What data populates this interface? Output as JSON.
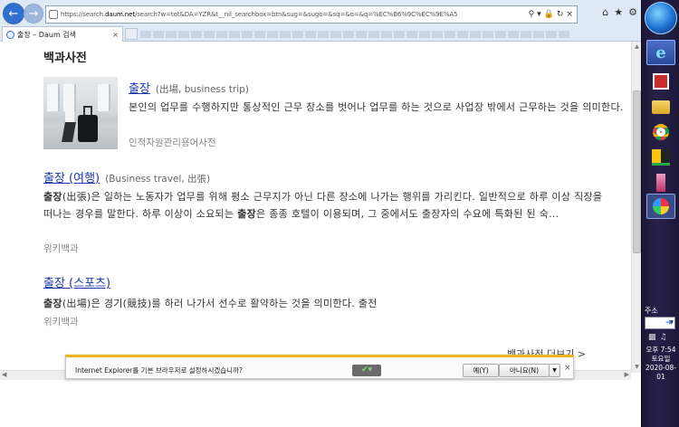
{
  "browser": {
    "url_prefix": "https://search.",
    "url_host": "daum.net",
    "url_rest": "/search?w=tot&DA=YZR&t__nil_searchbox=btn&sug=&sugo=&sq=&o=&q=%EC%B6%9C%EC%9E%A5",
    "tab_title": "출장 – Daum 검색",
    "tab_close": "×"
  },
  "page": {
    "section_title": "백과사전",
    "entries": [
      {
        "title": "출장",
        "subtitle": "(出場, business trip)",
        "description": "본인의 업무를 수행하지만 통상적인 근무 장소를 벗어나 업무를 하는 것으로 사업장 밖에서 근무하는 것을 의미한다.",
        "source": "인적자원관리용어사전"
      },
      {
        "title": "출장 (여행)",
        "subtitle": "(Business travel, 出張)",
        "description_bold_1": "출장",
        "description_part_1": "(出張)은 일하는 노동자가 업무를 위해 평소 근무지가 아닌 다른 장소에 나가는 행위를 가리킨다. 일반적으로 하루 이상 직장을 떠나는 경우를 말한다. 하루 이상이 소요되는 ",
        "description_bold_2": "출장",
        "description_part_2": "은 종종 호텔이 이용되며, 그 중에서도 출장자의 수요에 특화된 된 숙...",
        "source": "위키백과"
      },
      {
        "title": "출장 (스포츠)",
        "subtitle": "",
        "description_bold_1": "출장",
        "description_part_1": "(出場)은 경기(競技)를 하러 나가서 선수로 활약하는 것을 의미한다. 출전",
        "source": "위키백과"
      }
    ],
    "more_link": "백과사전 더보기 >"
  },
  "notification": {
    "message": "Internet Explorer를 기본 브라우저로 설정하시겠습니까?",
    "yes_label": "예(Y)",
    "no_label": "아니요(N)",
    "dropdown": "▼",
    "close": "×"
  },
  "taskbar": {
    "address_label": "주소",
    "clock_time": "오후 7:54",
    "clock_day": "토요일",
    "clock_date": "2020-08-01"
  },
  "colors": {
    "link": "#1b37a6",
    "notification_border": "#f1b21f",
    "taskbar_bg": "#26204a"
  },
  "icons": [
    "back-arrow-icon",
    "forward-arrow-icon",
    "lock-icon",
    "search-icon",
    "refresh-icon",
    "close-icon",
    "home-icon",
    "star-icon",
    "gear-icon",
    "start-orb-icon",
    "ie-icon",
    "chrome-icon",
    "folder-icon",
    "shield-icon"
  ]
}
